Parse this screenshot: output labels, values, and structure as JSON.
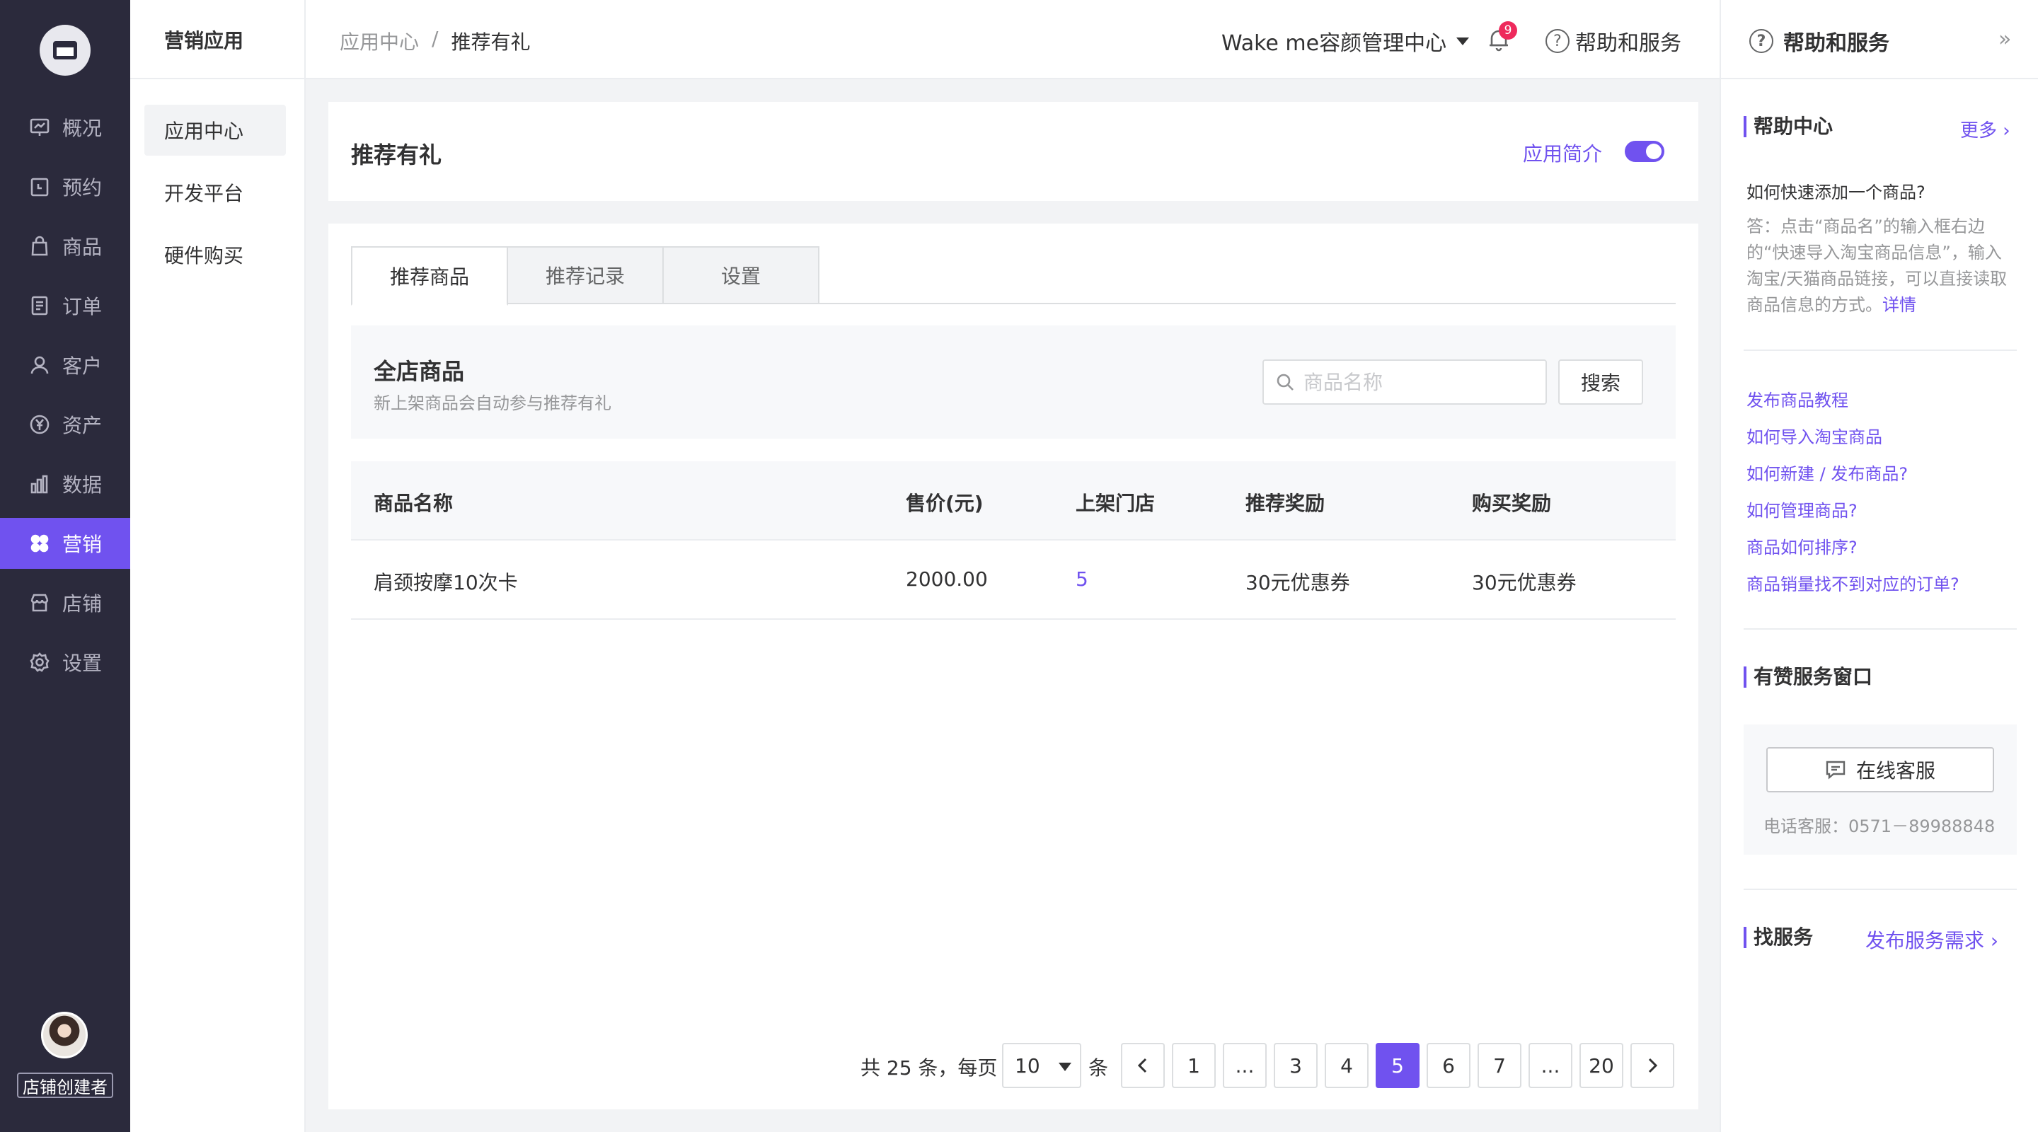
{
  "nav": {
    "items": [
      {
        "label": "概况",
        "icon": "overview-icon"
      },
      {
        "label": "预约",
        "icon": "calendar-icon"
      },
      {
        "label": "商品",
        "icon": "bag-icon"
      },
      {
        "label": "订单",
        "icon": "order-icon"
      },
      {
        "label": "客户",
        "icon": "user-icon"
      },
      {
        "label": "资产",
        "icon": "yuan-icon"
      },
      {
        "label": "数据",
        "icon": "bar-chart-icon"
      },
      {
        "label": "营销",
        "icon": "marketing-icon"
      },
      {
        "label": "店铺",
        "icon": "store-icon"
      },
      {
        "label": "设置",
        "icon": "gear-icon"
      }
    ],
    "active": "营销",
    "role": "店铺创建者"
  },
  "subnav": {
    "title": "营销应用",
    "items": [
      "应用中心",
      "开发平台",
      "硬件购买"
    ]
  },
  "header": {
    "breadcrumb": [
      "应用中心",
      "/",
      "推荐有礼"
    ],
    "shop_name": "Wake me容颜管理中心",
    "notification_count": "9",
    "help_label": "帮助和服务"
  },
  "page": {
    "title": "推荐有礼",
    "intro_label": "应用简介",
    "intro_toggle": "on"
  },
  "tabs": [
    "推荐商品",
    "推荐记录",
    "设置"
  ],
  "filter": {
    "title": "全店商品",
    "subtitle": "新上架商品会自动参与推荐有礼",
    "search_placeholder": "商品名称",
    "search_button": "搜索"
  },
  "table": {
    "columns": [
      "商品名称",
      "售价(元)",
      "上架门店",
      "推荐奖励",
      "购买奖励"
    ],
    "rows": [
      {
        "name": "肩颈按摩10次卡",
        "price": "2000.00",
        "stores": "5",
        "referral_reward": "30元优惠券",
        "purchase_reward": "30元优惠券"
      }
    ]
  },
  "pagination": {
    "total_text": "共 25 条，每页",
    "page_size": "10",
    "unit": "条",
    "pages": [
      "1",
      "...",
      "3",
      "4",
      "5",
      "6",
      "7",
      "...",
      "20"
    ],
    "current": "5"
  },
  "help_panel": {
    "title": "帮助和服务",
    "help_center": {
      "title": "帮助中心",
      "more": "更多",
      "question": "如何快速添加一个商品?",
      "answer": "答：点击“商品名”的输入框右边的“快速导入淘宝商品信息”，输入淘宝/天猫商品链接，可以直接读取商品信息的方式。",
      "detail": "详情",
      "links": [
        "发布商品教程",
        "如何导入淘宝商品",
        "如何新建 / 发布商品?",
        "如何管理商品?",
        "商品如何排序?",
        "商品销量找不到对应的订单?"
      ]
    },
    "service": {
      "title": "有赞服务窗口",
      "button": "在线客服",
      "phone": "电话客服：0571－89988848"
    },
    "find_service": {
      "title": "找服务",
      "link": "发布服务需求"
    }
  },
  "colors": {
    "accent": "#7052ef",
    "sidebar": "#2b2a3c",
    "badge": "#ee2a5c"
  }
}
